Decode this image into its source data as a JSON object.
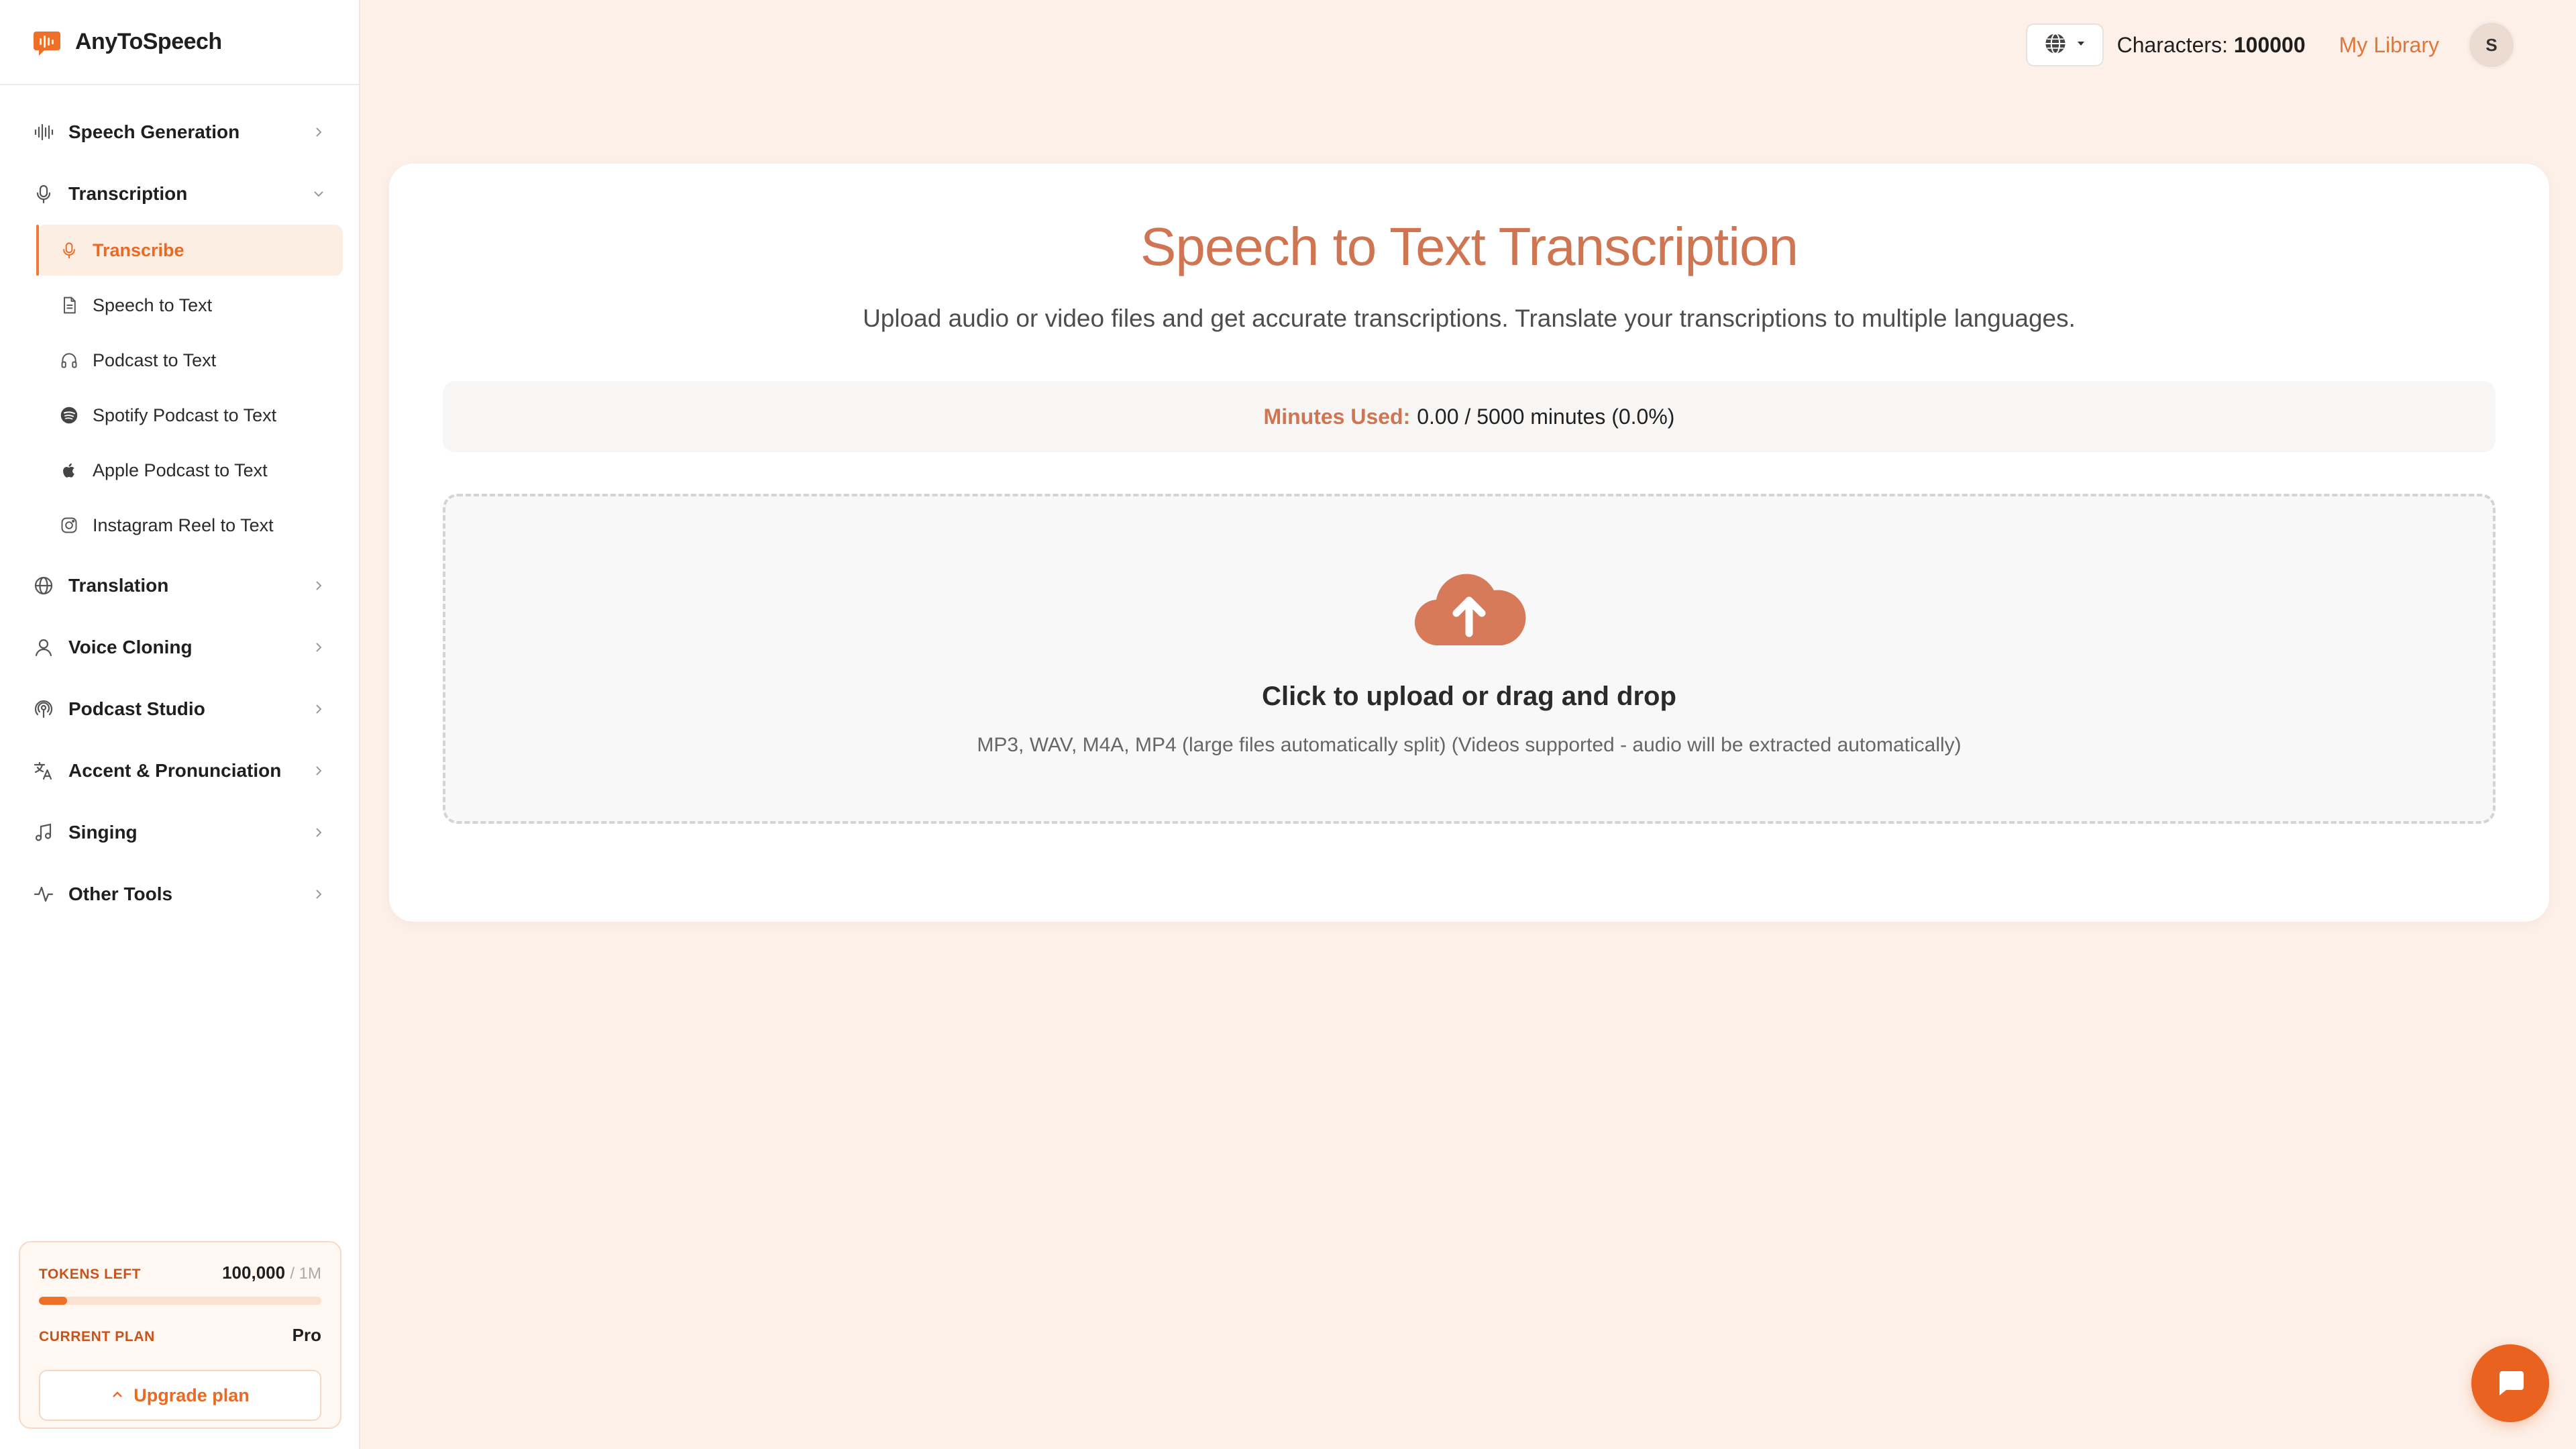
{
  "app": {
    "name": "AnyToSpeech"
  },
  "sidebar": {
    "sections": [
      {
        "label": "Speech Generation",
        "icon": "waveform-icon"
      },
      {
        "label": "Transcription",
        "icon": "microphone-icon",
        "expanded": true
      },
      {
        "label": "Translation",
        "icon": "globe-icon"
      },
      {
        "label": "Voice Cloning",
        "icon": "user-icon"
      },
      {
        "label": "Podcast Studio",
        "icon": "podcast-icon"
      },
      {
        "label": "Accent & Pronunciation",
        "icon": "translate-icon"
      },
      {
        "label": "Singing",
        "icon": "music-note-icon"
      },
      {
        "label": "Other Tools",
        "icon": "activity-icon"
      }
    ],
    "transcription_items": [
      {
        "label": "Transcribe",
        "icon": "microphone-icon",
        "active": true
      },
      {
        "label": "Speech to Text",
        "icon": "document-icon"
      },
      {
        "label": "Podcast to Text",
        "icon": "headphones-icon"
      },
      {
        "label": "Spotify Podcast to Text",
        "icon": "spotify-icon"
      },
      {
        "label": "Apple Podcast to Text",
        "icon": "apple-icon"
      },
      {
        "label": "Instagram Reel to Text",
        "icon": "instagram-icon"
      }
    ],
    "plan": {
      "tokens_label": "TOKENS LEFT",
      "tokens_value": "100,000",
      "tokens_total": "/ 1M",
      "tokens_fraction": 0.1,
      "plan_label": "CURRENT PLAN",
      "plan_value": "Pro",
      "upgrade_label": "Upgrade plan"
    }
  },
  "topbar": {
    "characters_label": "Characters:",
    "characters_value": "100000",
    "library_label": "My Library",
    "avatar_initial": "S"
  },
  "main": {
    "title": "Speech to Text Transcription",
    "subtitle": "Upload audio or video files and get accurate transcriptions. Translate your transcriptions to multiple languages.",
    "usage_label": "Minutes Used:",
    "usage_value": "0.00 / 5000 minutes (0.0%)",
    "upload_title": "Click to upload or drag and drop",
    "upload_hint": "MP3, WAV, M4A, MP4 (large files automatically split) (Videos supported - audio will be extracted automatically)"
  },
  "colors": {
    "accent": "#ea6a23",
    "title": "#cf7552",
    "background": "#fdf0e8"
  }
}
